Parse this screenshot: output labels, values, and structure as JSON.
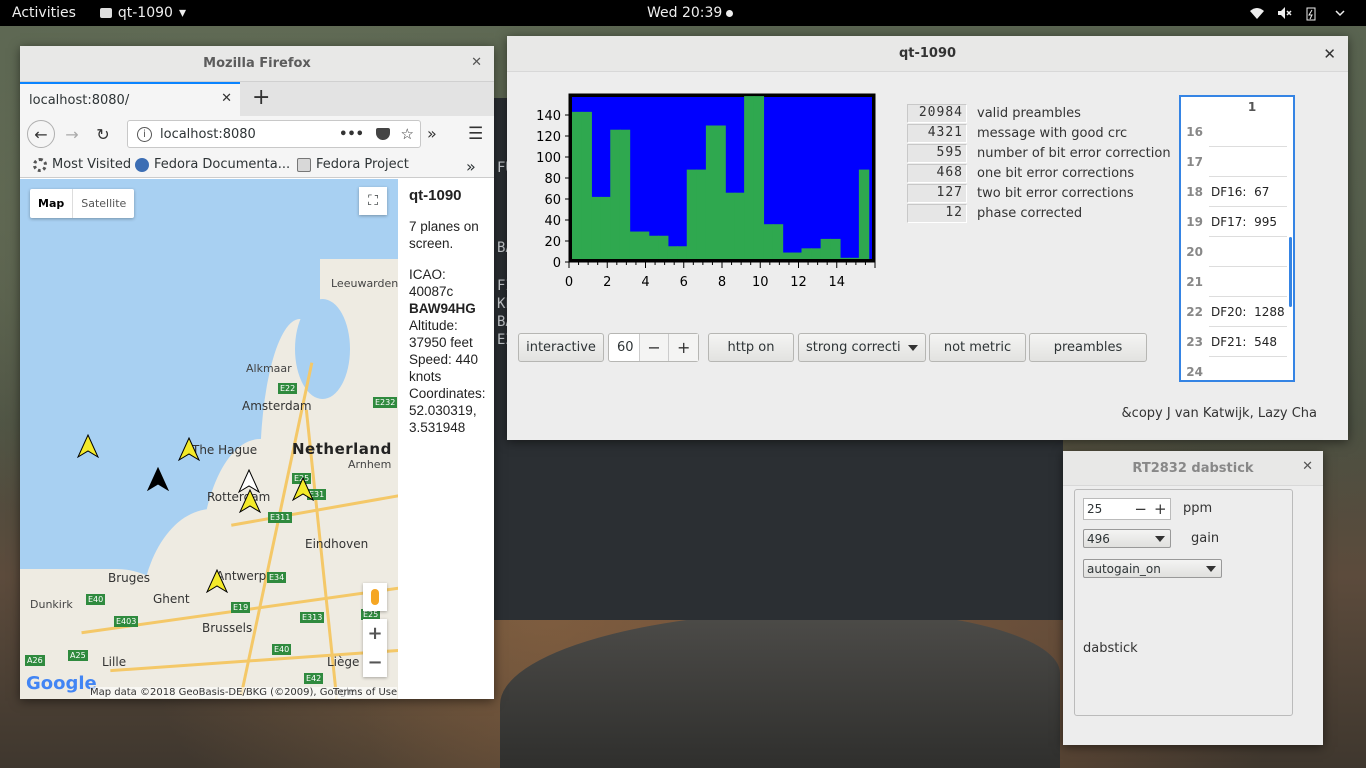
{
  "topbar": {
    "activities": "Activities",
    "app_name": "qt-1090",
    "clock": "Wed 20:39"
  },
  "terminal_lines": [
    "FU",
    "BA",
    "FI",
    "KL",
    "BA",
    "EZ"
  ],
  "firefox": {
    "window_title": "Mozilla Firefox",
    "tab_title": "localhost:8080/",
    "url": "localhost:8080",
    "bookmarks": [
      "Most Visited",
      "Fedora Documenta...",
      "Fedora Project"
    ],
    "map": {
      "map_button": "Map",
      "satellite_button": "Satellite",
      "labels": {
        "leeuwarden": "Leeuwarden",
        "alkmaar": "Alkmaar",
        "amsterdam": "Amsterdam",
        "the_hague": "The Hague",
        "netherlands": "Netherland",
        "arnhem": "Arnhem",
        "rotterdam": "Rotterdam",
        "eindhoven": "Eindhoven",
        "bruges": "Bruges",
        "antwerp": "Antwerp",
        "dunkirk": "Dunkirk",
        "ghent": "Ghent",
        "brussels": "Brussels",
        "lille": "Lille",
        "liege": "Liège"
      },
      "shields": [
        "E22",
        "E232",
        "E25",
        "E31",
        "E311",
        "E40",
        "E34",
        "E19",
        "E313",
        "E403",
        "E25",
        "A26",
        "A25",
        "E40",
        "E42"
      ],
      "logo": "Google",
      "attribution": "Map data ©2018 GeoBasis-DE/BKG (©2009), Google",
      "terms": "Terms of Use"
    },
    "info": {
      "title": "qt-1090",
      "planes": "7 planes on screen.",
      "icao_label": "ICAO:",
      "icao": "40087c",
      "callsign": "BAW94HG",
      "altitude_label": "Altitude:",
      "altitude": "37950 feet",
      "speed_label": "Speed: 440",
      "speed_unit": "knots",
      "coords_label": "Coordinates:",
      "lat": "52.030319,",
      "lon": "3.531948"
    }
  },
  "qt": {
    "window_title": "qt-1090",
    "counters": [
      {
        "value": "20984",
        "label": "valid preambles"
      },
      {
        "value": "4321",
        "label": "message with good crc"
      },
      {
        "value": "595",
        "label": "number of bit error correction"
      },
      {
        "value": "468",
        "label": "one bit error corrections"
      },
      {
        "value": "127",
        "label": "two bit error corrections"
      },
      {
        "value": "12",
        "label": "phase corrected"
      }
    ],
    "table": {
      "header": "1",
      "rows": [
        {
          "num": "16",
          "cell": ""
        },
        {
          "num": "17",
          "cell": ""
        },
        {
          "num": "18",
          "cell": "DF16:  67"
        },
        {
          "num": "19",
          "cell": "DF17:  995"
        },
        {
          "num": "20",
          "cell": ""
        },
        {
          "num": "21",
          "cell": ""
        },
        {
          "num": "22",
          "cell": "DF20:  1288"
        },
        {
          "num": "23",
          "cell": "DF21:  548"
        },
        {
          "num": "24",
          "cell": ""
        }
      ]
    },
    "buttons": {
      "interactive": "interactive",
      "spin_value": "60",
      "http": "http on",
      "correction": "strong correcti",
      "metric": "not metric",
      "preambles": "preambles"
    },
    "copyright": "&copy J van Katwijk, Lazy Cha"
  },
  "chart_data": {
    "type": "bar",
    "x": [
      0,
      0.5,
      1,
      1.5,
      2,
      2.5,
      3,
      3.5,
      4,
      4.5,
      5,
      5.5,
      6,
      6.5,
      7,
      7.5,
      8,
      8.5,
      9,
      9.5,
      10,
      10.5,
      11,
      11.5,
      12,
      12.5,
      13,
      13.5,
      14,
      14.5,
      15
    ],
    "values": [
      143,
      143,
      62,
      62,
      126,
      126,
      29,
      29,
      25,
      25,
      15,
      15,
      88,
      88,
      130,
      130,
      66,
      66,
      158,
      158,
      36,
      36,
      9,
      9,
      13,
      13,
      22,
      22,
      4,
      4,
      88
    ],
    "xticks": [
      "0",
      "2",
      "4",
      "6",
      "8",
      "10",
      "12",
      "14"
    ],
    "yticks": [
      "0",
      "20",
      "40",
      "60",
      "80",
      "100",
      "120",
      "140"
    ],
    "xlim": [
      0,
      16
    ],
    "ylim": [
      0,
      160
    ],
    "bg_color": "#0000ff",
    "bar_color": "#2fa84f"
  },
  "rt": {
    "window_title": "RT2832 dabstick",
    "ppm_value": "25",
    "ppm_label": "ppm",
    "gain_value": "496",
    "gain_label": "gain",
    "autogain": "autogain_on",
    "device": "dabstick"
  }
}
